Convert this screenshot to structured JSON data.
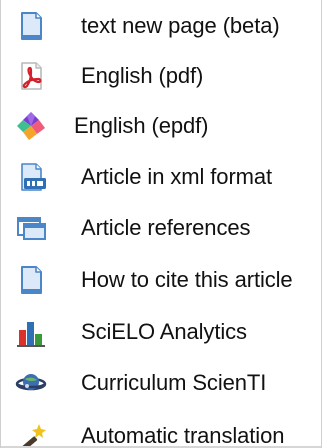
{
  "tools": {
    "items": [
      {
        "label": "text new page (beta)",
        "icon": "page-icon"
      },
      {
        "label": "English (pdf)",
        "icon": "pdf-icon"
      },
      {
        "label": "English (epdf)",
        "icon": "epdf-icon"
      },
      {
        "label": "Article in xml format",
        "icon": "xml-icon"
      },
      {
        "label": "Article references",
        "icon": "references-icon"
      },
      {
        "label": " How to cite this article",
        "icon": "page-icon"
      },
      {
        "label": "SciELO Analytics",
        "icon": "analytics-chart-icon"
      },
      {
        "label": "Curriculum ScienTI",
        "icon": "planet-icon"
      },
      {
        "label": "Automatic translation",
        "icon": "magic-wand-icon"
      }
    ]
  },
  "colors": {
    "page_icon_fill": "#dbe9f8",
    "page_icon_stroke": "#4a86c8",
    "pdf_red": "#d4202a",
    "xml_blue": "#2f6fb5",
    "chart_red": "#d9312b",
    "chart_blue": "#2f6fb5",
    "chart_green": "#3a9a3a"
  }
}
